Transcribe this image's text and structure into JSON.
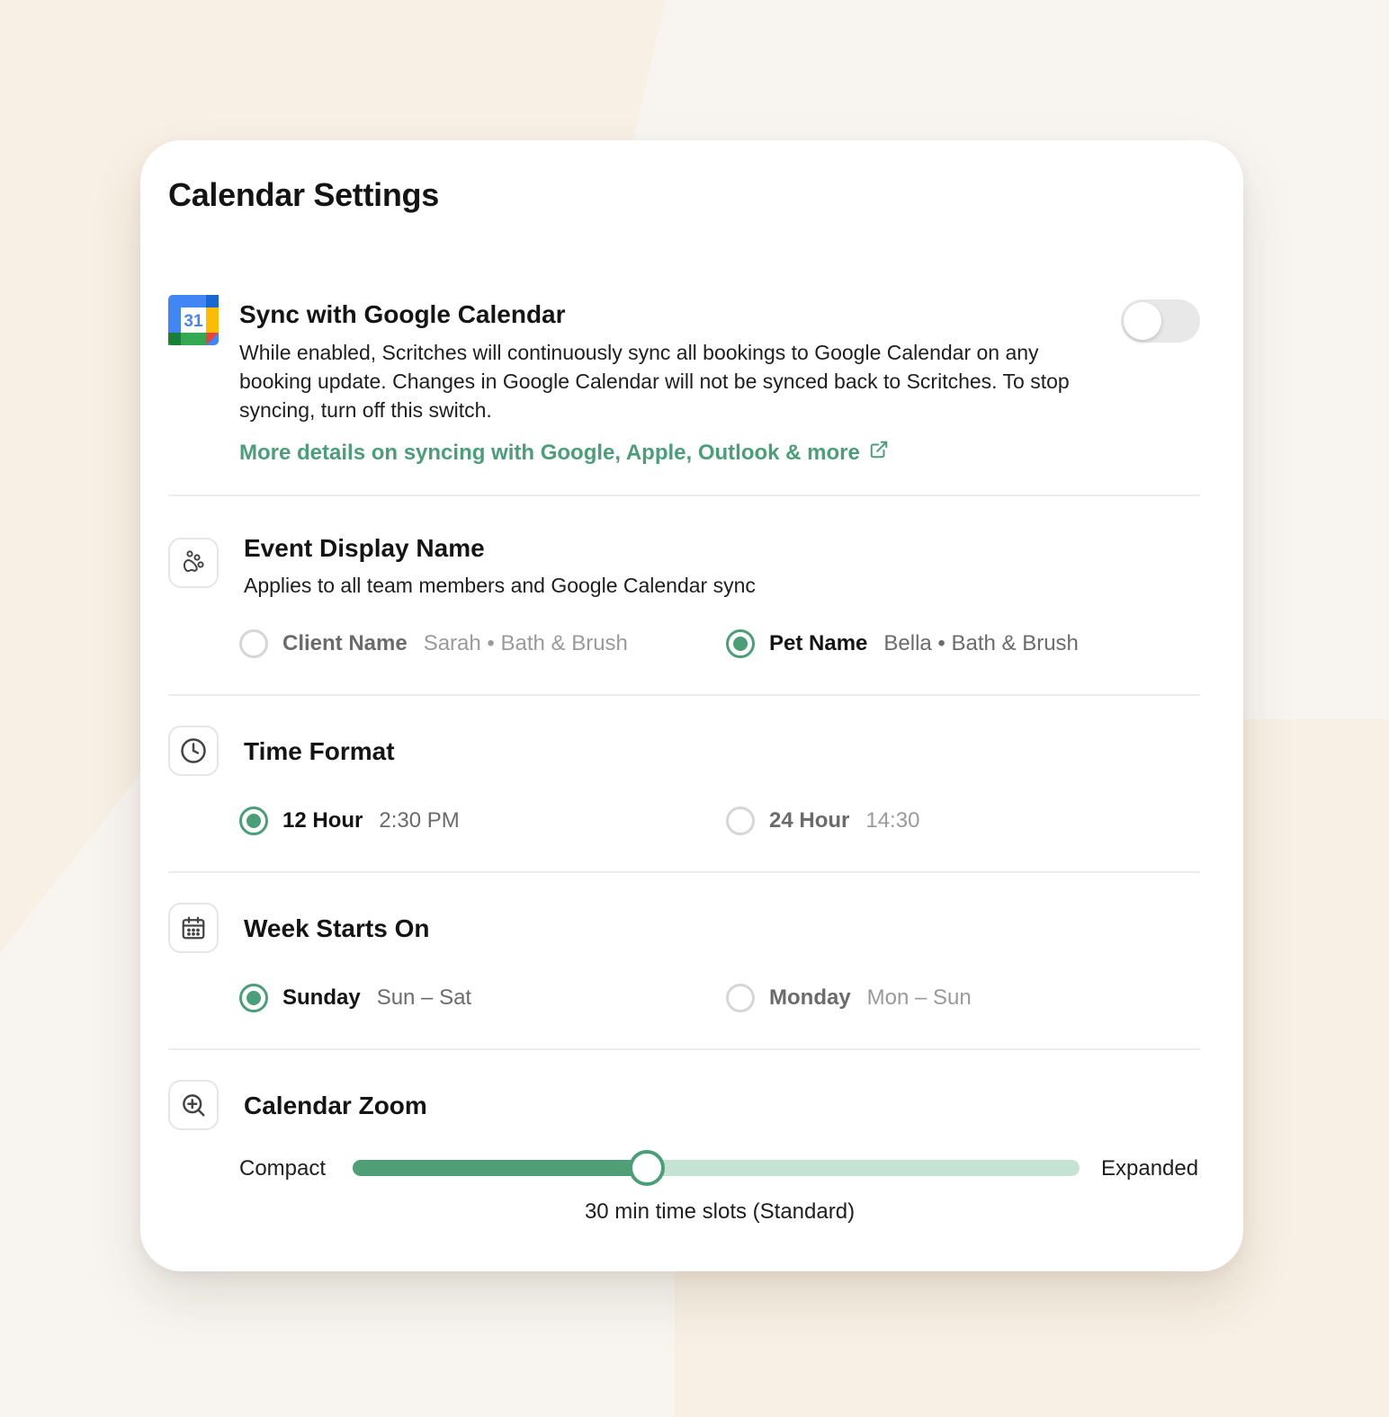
{
  "title": "Calendar Settings",
  "sync": {
    "icon": "google-calendar-icon",
    "icon_day": "31",
    "title": "Sync with Google Calendar",
    "description": "While enabled, Scritches will continuously sync all bookings to Google Calendar on any booking update. Changes in Google Calendar will not be synced back to Scritches. To stop syncing, turn off this switch.",
    "link_label": "More details on syncing with Google, Apple, Outlook & more",
    "link_icon": "external-link-icon",
    "enabled": false
  },
  "event_display": {
    "icon": "paw-icon",
    "title": "Event Display Name",
    "subtitle": "Applies to all team members and Google Calendar sync",
    "options": [
      {
        "label": "Client Name",
        "example": "Sarah • Bath & Brush",
        "selected": false
      },
      {
        "label": "Pet Name",
        "example": "Bella • Bath & Brush",
        "selected": true
      }
    ]
  },
  "time_format": {
    "icon": "clock-icon",
    "title": "Time Format",
    "options": [
      {
        "label": "12 Hour",
        "example": "2:30 PM",
        "selected": true
      },
      {
        "label": "24 Hour",
        "example": "14:30",
        "selected": false
      }
    ]
  },
  "week_start": {
    "icon": "calendar-icon",
    "title": "Week Starts On",
    "options": [
      {
        "label": "Sunday",
        "example": "Sun – Sat",
        "selected": true
      },
      {
        "label": "Monday",
        "example": "Mon – Sun",
        "selected": false
      }
    ]
  },
  "zoom": {
    "icon": "zoom-in-icon",
    "title": "Calendar Zoom",
    "min_label": "Compact",
    "max_label": "Expanded",
    "value_fraction": 0.405,
    "caption": "30 min time slots (Standard)"
  },
  "colors": {
    "accent": "#4a9e78",
    "slider_track": "#c4e3d2",
    "background": "#f8f5f1"
  }
}
